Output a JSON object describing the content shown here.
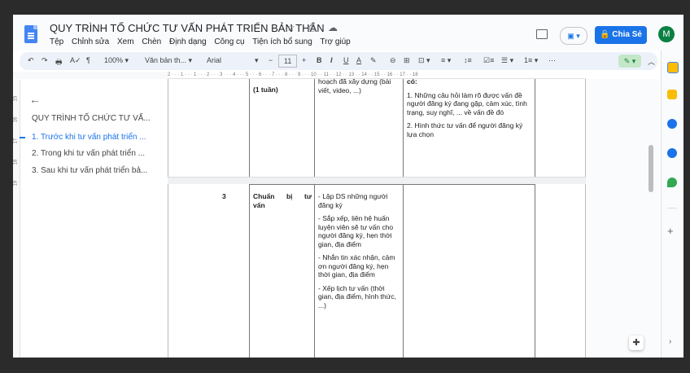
{
  "header": {
    "title": "QUY TRÌNH TỐ CHỨC TƯ VẤN PHÁT TRIỂN BẢN THÂN",
    "title_icons": "☆ ⎙ ☁",
    "menu": [
      "Tệp",
      "Chỉnh sửa",
      "Xem",
      "Chèn",
      "Định dạng",
      "Công cụ",
      "Tiện ích bổ sung",
      "Trợ giúp"
    ],
    "share_label": "Chia Sẻ",
    "avatar_letter": "M",
    "present_label": "▣ ▾"
  },
  "toolbar": {
    "undo": "↶",
    "redo": "↷",
    "print": "🖶",
    "spell": "A✓",
    "paint": "¶",
    "zoom": "100%",
    "style": "Văn bản th...",
    "font": "Arial",
    "font_size": "11",
    "minus": "−",
    "plus": "+",
    "bold": "B",
    "italic": "I",
    "underline": "U",
    "text_color": "A",
    "highlight": "✎",
    "link": "⊖",
    "comment": "⊞",
    "image": "⊡ ▾",
    "align": "≡ ▾",
    "line_spacing": "↕≡",
    "checklist": "☑≡",
    "bullets": "☰ ▾",
    "numbers": "1≡ ▾",
    "more": "⋯",
    "edit_mode": "✎ ▾",
    "collapse": "︿"
  },
  "ruler": "2 · · · 1 · · · 1 · · · 2 · · · 3 · · · 4 · · · 5 · · · 6 · · · 7 · · · 8 · · · 9 · · · 10 · · 11 · · 12 · · 13 · · 14 · · 15 · · 16 · · 17 · · 18",
  "vruler": [
    "15",
    "16",
    "17",
    "18",
    "19"
  ],
  "outline": {
    "back": "←",
    "title": "QUY TRÌNH TỐ CHỨC TƯ VẤ...",
    "items": [
      {
        "label": "1. Trước khi tư vấn phát triển ...",
        "active": true
      },
      {
        "label": "2. Trong khi tư vấn phát triển ...",
        "active": false
      },
      {
        "label": "3. Sau khi tư vấn phát triển bả...",
        "active": false
      }
    ]
  },
  "table": {
    "row1": {
      "duration": "(1 tuần)",
      "task": "hoạch đã xây dựng (bài viết, video, ...)",
      "note_heading": "có:",
      "note_1": "1. Những câu hỏi làm rõ được vấn đề người đăng ký đang gặp, cảm xúc, tình trạng, suy nghĩ, ... về vấn đề đó",
      "note_2": "2. Hình thức tư vấn để người đăng ký lựa chọn"
    },
    "row2": {
      "number": "3",
      "step": "Chuẩn bị tư vấn",
      "tasks": [
        "- Lập DS những người đăng ký",
        "- Sắp xếp, liên hệ huấn luyện viên sẽ tư vấn cho người đăng ký, hẹn thời gian, địa điểm",
        "- Nhắn tin xác nhận, cảm ơn người đăng ký, hẹn thời gian, địa điểm",
        "- Xếp lịch tư vấn (thời gian, địa điểm, hình thức, ...)"
      ]
    }
  },
  "side_panel": {
    "plus": "+",
    "chevron": "›"
  },
  "explore": "✚",
  "colors": {
    "accent": "#1a73e8",
    "avatar": "#0b8043",
    "doc": "#4285f4"
  }
}
